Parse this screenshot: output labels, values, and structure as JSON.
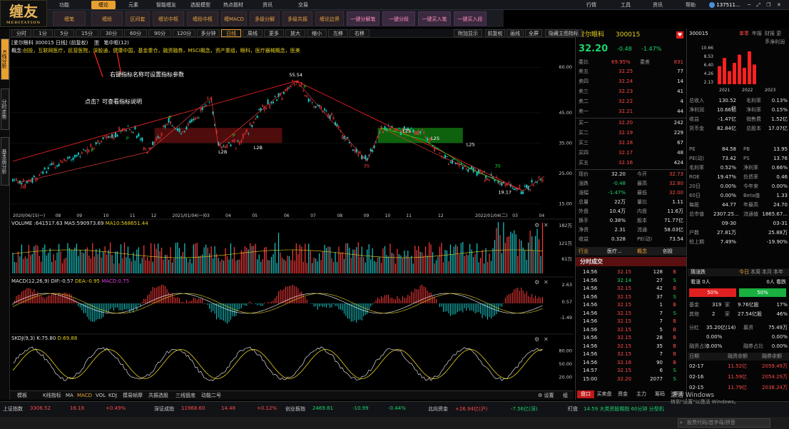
{
  "logo": {
    "text": "缠友",
    "sub": "MEDITATION"
  },
  "top_menu": [
    "功能",
    "缠论",
    "元素",
    "智能缠友",
    "选股模型",
    "热点题材",
    "资讯",
    "交易"
  ],
  "top_right_menu": [
    "行情",
    "工具",
    "资讯",
    "帮助"
  ],
  "user": "137511...",
  "toolbar": [
    "缠笔",
    "缠段",
    "区间套",
    "缠论中枢",
    "缠段中枢",
    "缠MACD",
    "多级分解",
    "多级共振",
    "缠论边界",
    "一键分解笔",
    "一键分段",
    "一键买入笔",
    "一键买入段"
  ],
  "side_tabs": [
    "K线分析",
    "分时走势",
    "基本面分析"
  ],
  "periods": [
    "分时",
    "1分",
    "5分",
    "15分",
    "30分",
    "60分",
    "90分",
    "120分",
    "多分钟",
    "日线",
    "周线",
    "更多",
    "放大",
    "缩小",
    "左移",
    "右移"
  ],
  "chart_right_buttons": [
    "附加显示",
    "前复权",
    "画线",
    "全屏",
    "隐藏主图指标"
  ],
  "chart": {
    "header": "[爱尔眼科 300015 日线]",
    "header_fq": "(前复权)",
    "header_q": "?",
    "indicator": "笔中枢(12)",
    "concepts_label": "概念:",
    "concepts": "创投，互联网医疗，民营医院，深股通，健康中国，基金重仓，融资融券，MSCI概念，资产重组，眼科，医疗器械概念，医美",
    "annot1": "右键指标名称可设置指标参数",
    "annot2": "点击？可查看指标说明",
    "price_ticks": [
      "60.00",
      "45.00",
      "35.00",
      "25.00",
      "15.00"
    ],
    "date_ticks": [
      "2020/06/15(一)",
      "08",
      "09",
      "10",
      "11",
      "12",
      "2021/01/04(一)",
      "03",
      "04",
      "05",
      "06",
      "07",
      "08",
      "09",
      "10",
      "11",
      "12",
      "2022/01/04(二)",
      "03",
      "04"
    ],
    "marks": [
      "3B",
      "P",
      "P",
      "P",
      "P",
      "L2B",
      "L2B",
      "55.54",
      "P",
      "3S",
      "L2S",
      "L2S",
      "L2S",
      "3S",
      "P",
      "19.17"
    ],
    "vol_legend": "VOLUME :641517.63 MA5:590973.69",
    "vol_ma10": "MA10:568651.44",
    "vol_ticks": [
      "182万",
      "121万",
      "61万"
    ],
    "macd_legend": "MACD(12,26,9) DIF:-0.57",
    "macd_dea": "DEA:-0.95",
    "macd_val": "MACD:0.75",
    "macd_ticks": [
      "2.63",
      "0.57",
      "-1.49"
    ],
    "kdj_legend": "SKDJ(9,3) K:75.80",
    "kdj_d": "D:69.88",
    "kdj_ticks": [
      "80.00",
      "50.00",
      "20.00"
    ]
  },
  "bottom_tabs": [
    "模板",
    "K线指标",
    "MA",
    "MACD",
    "VOL",
    "KDJ",
    "摸易帧摩",
    "共振选股",
    "三线狙底",
    "动能二号"
  ],
  "bottom_right": [
    "设置",
    "组"
  ],
  "quote": {
    "name": "爱尔眼科",
    "code": "300015",
    "price": "32.20",
    "change": "-0.48",
    "pct": "-1.47%",
    "ratio_label": "委比",
    "ratio": "69.95%",
    "diff_label": "委差",
    "diff": "831",
    "asks": [
      [
        "卖五",
        "32.25",
        "77"
      ],
      [
        "卖四",
        "32.24",
        "14"
      ],
      [
        "卖三",
        "32.23",
        "41"
      ],
      [
        "卖二",
        "32.22",
        "4"
      ],
      [
        "卖一",
        "32.21",
        "44"
      ]
    ],
    "bids": [
      [
        "买一",
        "32.20",
        "242"
      ],
      [
        "买二",
        "32.19",
        "229"
      ],
      [
        "买三",
        "32.18",
        "67"
      ],
      [
        "买四",
        "32.17",
        "48"
      ],
      [
        "买五",
        "32.16",
        "424"
      ]
    ],
    "stats": [
      [
        "现价",
        "32.20",
        "今开",
        "32.73"
      ],
      [
        "涨跌",
        "-0.48",
        "最高",
        "32.80"
      ],
      [
        "涨幅",
        "-1.47%",
        "最低",
        "32.00"
      ],
      [
        "总量",
        "22万",
        "量比",
        "1.11"
      ],
      [
        "外盘",
        "10.4万",
        "内盘",
        "11.6万"
      ],
      [
        "换手",
        "0.38%",
        "股本",
        "71.77亿"
      ],
      [
        "净资",
        "2.31",
        "流通",
        "58.03亿"
      ],
      [
        "收益",
        "0.328",
        "PE(动)",
        "73.54"
      ]
    ],
    "industry": [
      "行业",
      "医疗...",
      "概念",
      "创投"
    ],
    "ticks_title": "分时成交",
    "ticks": [
      [
        "14:56",
        "32.15",
        "128",
        "B"
      ],
      [
        "14:56",
        "32.14",
        "27",
        "S"
      ],
      [
        "14:56",
        "32.15",
        "42",
        "B"
      ],
      [
        "14:56",
        "32.15",
        "37",
        "S"
      ],
      [
        "14:56",
        "32.15",
        "1",
        "B"
      ],
      [
        "14:56",
        "32.15",
        "7",
        "S"
      ],
      [
        "14:56",
        "32.15",
        "7",
        "B"
      ],
      [
        "14:56",
        "32.15",
        "5",
        "B"
      ],
      [
        "14:56",
        "32.15",
        "28",
        "B"
      ],
      [
        "14:56",
        "32.15",
        "35",
        "B"
      ],
      [
        "14:56",
        "32.15",
        "7",
        "B"
      ],
      [
        "14:56",
        "32.16",
        "90",
        "B"
      ],
      [
        "14:57",
        "32.15",
        "6",
        "S"
      ],
      [
        "15:00",
        "32.20",
        "2077",
        "S"
      ]
    ],
    "bottom_tabs": [
      "盘口",
      "买卖盘",
      "资金",
      "主力",
      "筹码",
      "异动"
    ]
  },
  "fin": {
    "code": "300015",
    "tabs": [
      "单季",
      "年报",
      "财报 更多..."
    ],
    "net_profit_label": "净利润",
    "y_ticks": [
      "10.66",
      "8.53",
      "6.40",
      "4.26",
      "2.13"
    ],
    "years": [
      "2021",
      "2022",
      "2023"
    ],
    "bars": [
      0.55,
      0.8,
      0.4,
      0.65,
      0.9,
      0.5,
      1.0,
      0.6
    ],
    "rows": [
      [
        "总收入",
        "130.52亿",
        "毛利率",
        "0.13%"
      ],
      [
        "净利润",
        "10.66亿",
        "净利率",
        "0.15%"
      ],
      [
        "收益",
        "-1.47亿",
        "销售费",
        "1.52亿"
      ],
      [
        "货币金",
        "82.84亿",
        "总股本",
        "17.07亿"
      ]
    ],
    "rows2": [
      [
        "PE",
        "84.58",
        "PB",
        "13.95"
      ],
      [
        "PE(动)",
        "73.42",
        "PS",
        "13.76"
      ],
      [
        "毛利率",
        "0.52%",
        "净利率",
        "0.66%"
      ],
      [
        "ROE",
        "19.47%",
        "负债率",
        "0.46"
      ],
      [
        "20日",
        "0.00%",
        "今年来",
        "0.00%"
      ],
      [
        "60日",
        "0.00%",
        "Beta值",
        "1.33"
      ],
      [
        "每股",
        "44.77",
        "年最高",
        "24.70"
      ],
      [
        "总市值",
        "2307.25...",
        "流通值",
        "1865.67..."
      ],
      [
        "",
        "09-30",
        "",
        "03-31"
      ],
      [
        "户数",
        "27.81万",
        "",
        "25.88万"
      ],
      [
        "较上期",
        "7.49%",
        "",
        "-19.90%"
      ]
    ],
    "flow_title": "猜涨跌",
    "flow_tabs": [
      "今日",
      "本周",
      "本月",
      "本年"
    ],
    "flow_left": "看涨 0人",
    "flow_right": "0人 看跌",
    "flow_pct_l": "50%",
    "flow_pct_r": "50%",
    "fund_rows": [
      [
        "基金",
        "319",
        "家",
        "9.76亿股",
        "17%"
      ],
      [
        "其他",
        "2",
        "家",
        "27.54亿股",
        "46%"
      ]
    ],
    "rows3": [
      [
        "分红",
        "35.20亿(14)",
        "募资",
        "75.49万"
      ],
      [
        "",
        "0.00%",
        "",
        "0.00%"
      ],
      [
        "融资占比",
        "0.00%",
        "融券占比",
        "0.00%"
      ]
    ],
    "margin_head": [
      "日期",
      "融资余额",
      "融券余额"
    ],
    "margin": [
      [
        "02-17",
        "11.52亿",
        "2059.49万"
      ],
      [
        "02-16",
        "11.59亿",
        "2054.29万"
      ],
      [
        "02-15",
        "11.79亿",
        "2038.24万"
      ]
    ]
  },
  "status": {
    "items": [
      [
        "上证指数",
        "3306.52",
        "16.18",
        "+0.49%"
      ],
      [
        "深证成指",
        "11968.60",
        "14.48",
        "+0.12%"
      ],
      [
        "创业板指",
        "2469.81",
        "-10.99",
        "-0.44%"
      ]
    ],
    "north_label": "北向资金",
    "north": "+26.94亿(沪)",
    "north2": "-7.56亿(深)",
    "stare_label": "盯盘",
    "stare": "14:59 大类资股期指 60分钟 分型机"
  },
  "taskbar": {
    "search": "股票代码/首字母/拼音",
    "win": "激活 Windows",
    "win2": "转到\"设置\"以激活 Windows。"
  }
}
